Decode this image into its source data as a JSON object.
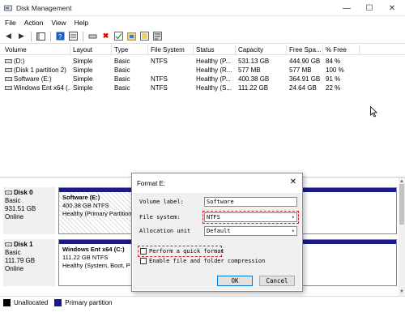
{
  "window": {
    "title": "Disk Management",
    "controls": {
      "minimize": "—",
      "maximize": "☐",
      "close": "✕"
    }
  },
  "menu": [
    "File",
    "Action",
    "View",
    "Help"
  ],
  "grid": {
    "columns": [
      "Volume",
      "Layout",
      "Type",
      "File System",
      "Status",
      "Capacity",
      "Free Spa...",
      "% Free"
    ],
    "rows": [
      [
        "(D:)",
        "Simple",
        "Basic",
        "NTFS",
        "Healthy (P...",
        "531.13 GB",
        "444.90 GB",
        "84 %"
      ],
      [
        "(Disk 1 partition 2)",
        "Simple",
        "Basic",
        "",
        "Healthy (R...",
        "577 MB",
        "577 MB",
        "100 %"
      ],
      [
        "Software (E:)",
        "Simple",
        "Basic",
        "NTFS",
        "Healthy (P...",
        "400.38 GB",
        "364.91 GB",
        "91 %"
      ],
      [
        "Windows Ent x64 (...",
        "Simple",
        "Basic",
        "NTFS",
        "Healthy (S...",
        "111.22 GB",
        "24.64 GB",
        "22 %"
      ]
    ]
  },
  "disks": [
    {
      "name": "Disk 0",
      "type": "Basic",
      "size": "931.51 GB",
      "status": "Online",
      "partition": {
        "title": "Software  (E:)",
        "detail": "400.38 GB NTFS",
        "status": "Healthy (Primary Partition"
      }
    },
    {
      "name": "Disk 1",
      "type": "Basic",
      "size": "111.79 GB",
      "status": "Online",
      "partition": {
        "title": "Windows Ent x64  (C:)",
        "detail": "111.22 GB NTFS",
        "status": "Healthy (System, Boot, P"
      }
    }
  ],
  "legend": {
    "unallocated": "Unallocated",
    "primary": "Primary partition"
  },
  "dialog": {
    "title": "Format E:",
    "volume_label": {
      "label": "Volume label:",
      "value": "Software"
    },
    "file_system": {
      "label": "File system:",
      "value": "NTFS"
    },
    "allocation_unit": {
      "label": "Allocation unit",
      "value": "Default"
    },
    "quick_format": {
      "label": "Perform a quick format",
      "checked": false
    },
    "compression": {
      "label": "Enable file and folder compression",
      "checked": false
    },
    "ok_label": "OK",
    "cancel_label": "Cancel"
  },
  "colors": {
    "primary_partition": "#1a1a8a",
    "unallocated": "#000000",
    "highlight": "#d42020"
  }
}
